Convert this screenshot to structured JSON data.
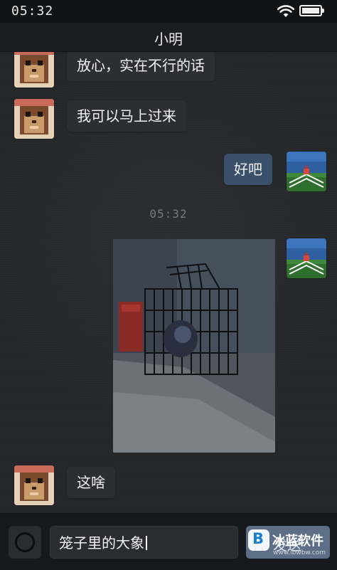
{
  "status_bar": {
    "time": "05:32",
    "icons": [
      "wifi-icon",
      "battery-icon"
    ]
  },
  "header": {
    "title": "小明"
  },
  "messages": [
    {
      "sender": "contact",
      "avatar": "hamster-avatar",
      "text": "放心，实在不行的话"
    },
    {
      "sender": "contact",
      "avatar": "hamster-avatar",
      "text": "我可以马上过来"
    },
    {
      "sender": "me",
      "avatar": "landscape-avatar",
      "text": "好吧"
    },
    {
      "sender": "me",
      "avatar": "landscape-avatar",
      "type": "image",
      "image": "photo of a wire cage"
    },
    {
      "sender": "contact",
      "avatar": "hamster-avatar",
      "text": "这啥"
    }
  ],
  "timestamp": "05:32",
  "input": {
    "value": "笼子里的大象",
    "send_label": "发送"
  },
  "watermark": {
    "logo_letter": "B",
    "name": "冰蓝软件",
    "url": "www.lbwbw.com"
  },
  "colors": {
    "background": "#24262a",
    "contact_bubble": "#2c2e32",
    "my_bubble": "#3a4f6a",
    "send_button": "#5c6f86"
  }
}
